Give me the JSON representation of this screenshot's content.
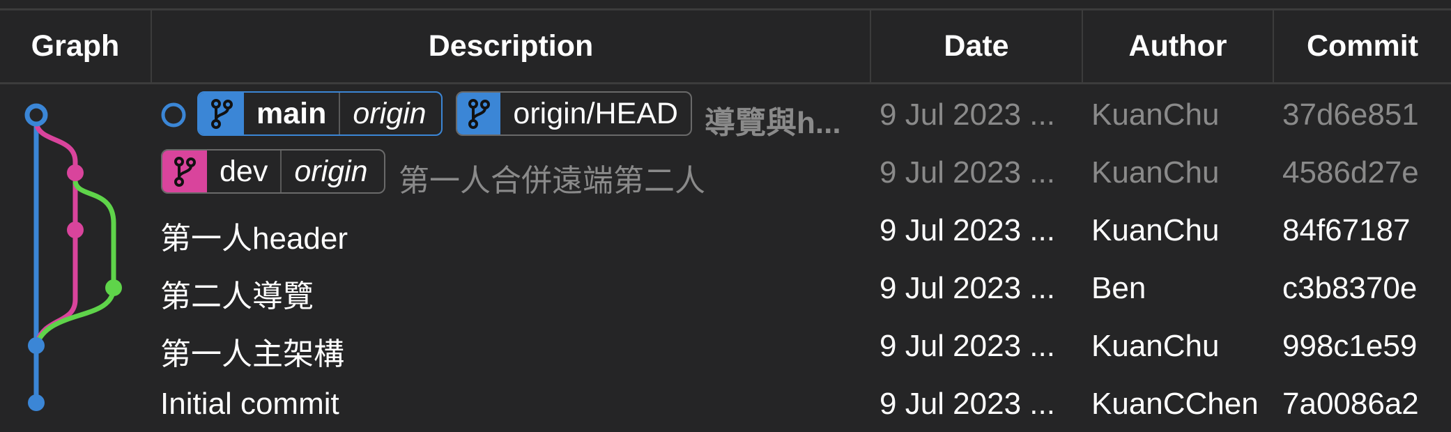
{
  "columns": {
    "graph": "Graph",
    "description": "Description",
    "date": "Date",
    "author": "Author",
    "commit": "Commit"
  },
  "colors": {
    "main_branch": "#3b86d6",
    "dev_branch": "#d9449c",
    "feature_branch": "#5fd44a",
    "background": "#252526"
  },
  "branch_icon": "git-branch-icon",
  "commits": [
    {
      "refs": [
        {
          "name": "main",
          "remote": "origin",
          "color": "#3b86d6"
        },
        {
          "name": "origin/HEAD",
          "color": "#3b86d6"
        }
      ],
      "message": "導覽與h...",
      "date": "9 Jul 2023 ...",
      "author": "KuanChu",
      "hash": "37d6e851"
    },
    {
      "refs": [
        {
          "name": "dev",
          "remote": "origin",
          "color": "#d9449c"
        }
      ],
      "message": "第一人合併遠端第二人",
      "date": "9 Jul 2023 ...",
      "author": "KuanChu",
      "hash": "4586d27e"
    },
    {
      "message": "第一人header",
      "date": "9 Jul 2023 ...",
      "author": "KuanChu",
      "hash": "84f67187"
    },
    {
      "message": "第二人導覽",
      "date": "9 Jul 2023 ...",
      "author": "Ben",
      "hash": "c3b8370e"
    },
    {
      "message": "第一人主架構",
      "date": "9 Jul 2023 ...",
      "author": "KuanChu",
      "hash": "998c1e59"
    },
    {
      "message": "Initial commit",
      "date": "9 Jul 2023 ...",
      "author": "KuanCChen",
      "hash": "7a0086a2"
    }
  ]
}
